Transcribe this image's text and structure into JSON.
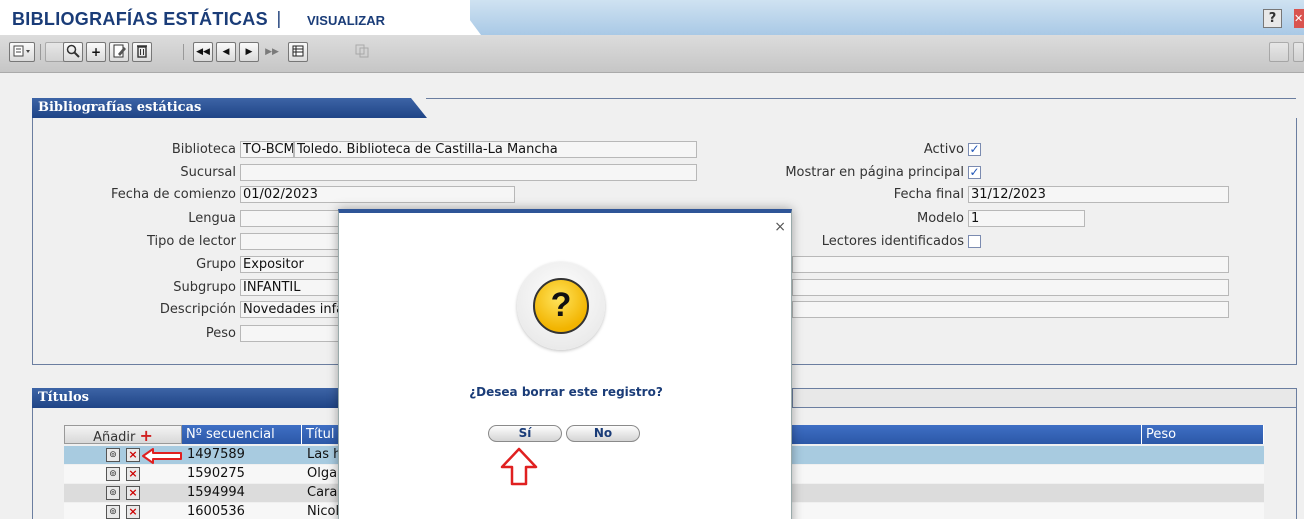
{
  "header": {
    "title": "BIBLIOGRAFÍAS ESTÁTICAS",
    "separator": "|",
    "subtitle": "VISUALIZAR",
    "help_label": "?",
    "close_label": "✕"
  },
  "toolbar": {
    "icons": [
      "list-menu-icon",
      "search-icon",
      "add-icon",
      "edit-icon",
      "delete-icon",
      "first-record-icon",
      "previous-record-icon",
      "next-record-icon",
      "last-record-icon",
      "grid-view-icon",
      "copy-icon"
    ]
  },
  "panel_main": {
    "title": "Bibliografías estáticas",
    "fields": {
      "biblioteca": {
        "label": "Biblioteca",
        "code": "TO-BCM",
        "value": "Toledo. Biblioteca de Castilla-La Mancha"
      },
      "sucursal": {
        "label": "Sucursal",
        "value": ""
      },
      "fecha_comienzo": {
        "label": "Fecha de comienzo",
        "value": "01/02/2023"
      },
      "lengua": {
        "label": "Lengua",
        "value": ""
      },
      "tipo_lector": {
        "label": "Tipo de lector",
        "value": ""
      },
      "grupo": {
        "label": "Grupo",
        "value": "Expositor"
      },
      "subgrupo": {
        "label": "Subgrupo",
        "value": "INFANTIL"
      },
      "descripcion": {
        "label": "Descripción",
        "value": "Novedades infa"
      },
      "peso": {
        "label": "Peso",
        "value": ""
      },
      "activo": {
        "label": "Activo",
        "checked": true
      },
      "mostrar_pagina": {
        "label": "Mostrar en página principal",
        "checked": true
      },
      "fecha_final": {
        "label": "Fecha final",
        "value": "31/12/2023"
      },
      "modelo": {
        "label": "Modelo",
        "value": "1"
      },
      "lectores_identificados": {
        "label": "Lectores identificados",
        "checked": false
      }
    }
  },
  "panel_titulos": {
    "title": "Títulos",
    "columns": {
      "add": "Añadir",
      "add_symbol": "+",
      "secuencial": "Nº secuencial",
      "titulo": "Títul",
      "peso": "Peso"
    },
    "rows": [
      {
        "secuencial": "1497589",
        "titulo": "Las h"
      },
      {
        "secuencial": "1590275",
        "titulo": "Olga"
      },
      {
        "secuencial": "1594994",
        "titulo": "Cara"
      },
      {
        "secuencial": "1600536",
        "titulo": "Nicol"
      }
    ]
  },
  "dialog": {
    "close_label": "×",
    "icon_glyph": "?",
    "message": "¿Desea borrar este registro?",
    "yes_label": "Sí",
    "no_label": "No"
  },
  "colors": {
    "accent": "#2f5597",
    "header_text": "#1a3c78",
    "selected_row": "#a8cbe0",
    "annotation": "#e02020"
  }
}
